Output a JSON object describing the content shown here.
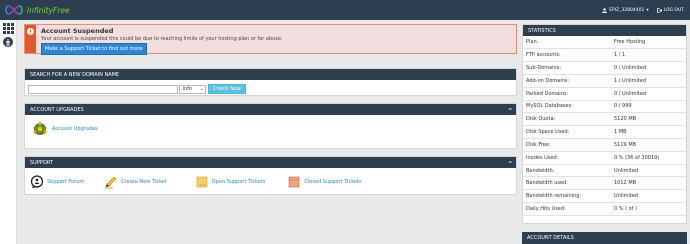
{
  "header": {
    "logo_text": "InfinityFree",
    "user": "EPIZ_32804401",
    "logout": "LOG OUT"
  },
  "alert": {
    "title": "Account Suspended",
    "text": "Your account is suspended this could be due to reaching limits of your hosting plan or for abuse.",
    "button": "Make a Support Ticket to find out more"
  },
  "search": {
    "title": "SEARCH FOR A NEW DOMAIN NAME",
    "input_value": "",
    "tld": ".info",
    "button": "Check Now"
  },
  "upgrades": {
    "title": "ACCOUNT UPGRADES",
    "collapse": "–",
    "link": "Account Upgrades"
  },
  "support": {
    "title": "SUPPORT",
    "collapse": "–",
    "items": [
      "Support Forum",
      "Create New Ticket",
      "Open Support Tickets",
      "Closed Support Tickets"
    ]
  },
  "statistics": {
    "title": "STATISTICS",
    "rows": [
      {
        "label": "Plan:",
        "value": "Free Hosting"
      },
      {
        "label": "FTP accounts:",
        "value": "1 / 1"
      },
      {
        "label": "Sub-Domains:",
        "value": "0 / Unlimited"
      },
      {
        "label": "Add-on Domains:",
        "value": "1 / Unlimited"
      },
      {
        "label": "Parked Domains:",
        "value": "0 / Unlimited"
      },
      {
        "label": "MySQL Databases:",
        "value": "0 / 999"
      },
      {
        "label": "Disk Quota:",
        "value": "5120 MB"
      },
      {
        "label": "Disk Space Used:",
        "value": "1 MB"
      },
      {
        "label": "Disk Free:",
        "value": "5119 MB"
      },
      {
        "label": "Inodes Used:",
        "value": "0 % (36 of 30019)"
      },
      {
        "label": "Bandwidth:",
        "value": "Unlimited"
      },
      {
        "label": "Bandwidth used:",
        "value": "1012 MB"
      },
      {
        "label": "Bandwidth remaining:",
        "value": "Unlimited"
      },
      {
        "label": "Daily Hits Used:",
        "value": "0 % ( of )"
      }
    ]
  },
  "account_details": {
    "title": "ACCOUNT DETAILS"
  }
}
